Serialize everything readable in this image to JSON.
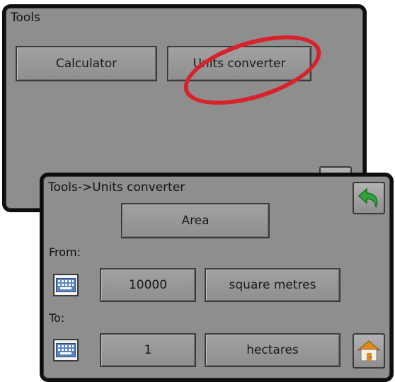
{
  "tools_screen": {
    "title": "Tools",
    "buttons": {
      "calculator": "Calculator",
      "units_converter": "Units converter"
    }
  },
  "units_converter_screen": {
    "title": "Tools->Units converter",
    "category": "Area",
    "from": {
      "label": "From:",
      "value": "10000",
      "unit": "square metres"
    },
    "to": {
      "label": "To:",
      "value": "1",
      "unit": "hectares"
    }
  },
  "icons": {
    "back": "back-arrow-icon",
    "home": "home-icon",
    "keyboard": "keyboard-icon"
  },
  "colors": {
    "panel_bg": "#8e8e8e",
    "callout_red": "#d8222b",
    "back_arrow_green": "#2fa43a",
    "home_orange": "#e08a1e"
  }
}
